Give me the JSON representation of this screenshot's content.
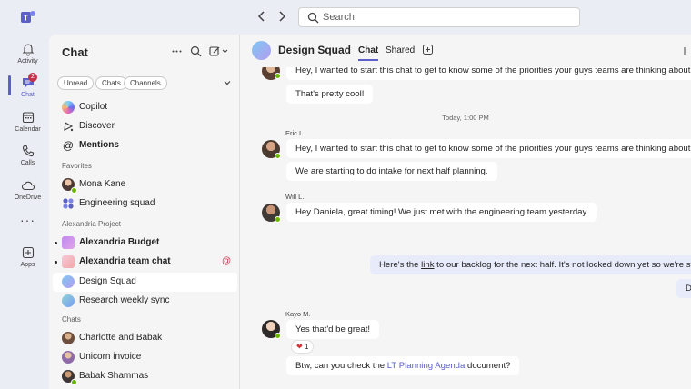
{
  "search": {
    "placeholder": "Search"
  },
  "rail": [
    {
      "label": "Activity",
      "icon": "bell-icon"
    },
    {
      "label": "Chat",
      "icon": "chat-icon",
      "badge": "2",
      "active": true
    },
    {
      "label": "Calendar",
      "icon": "calendar-icon"
    },
    {
      "label": "Calls",
      "icon": "phone-icon"
    },
    {
      "label": "OneDrive",
      "icon": "cloud-icon"
    },
    {
      "label": "Apps",
      "icon": "apps-icon"
    }
  ],
  "panel": {
    "title": "Chat",
    "filters": [
      "Unread",
      "Chats",
      "Channels"
    ],
    "top_items": [
      "Copilot",
      "Discover",
      "Mentions"
    ],
    "favorites_label": "Favorites",
    "favorites": [
      "Mona Kane",
      "Engineering squad"
    ],
    "project_label": "Alexandria Project",
    "project": [
      "Alexandria Budget",
      "Alexandria team chat",
      "Design Squad",
      "Research weekly sync"
    ],
    "mention_badge": "@",
    "chats_label": "Chats",
    "chats": [
      "Charlotte and Babak",
      "Unicorn invoice",
      "Babak Shammas"
    ]
  },
  "header": {
    "title": "Design Squad",
    "tabs": [
      "Chat",
      "Shared"
    ]
  },
  "messages": {
    "m1": "Hey, I wanted to start this chat to get to know some of the priorities your guys teams are thinking about",
    "m2": "That's pretty cool!",
    "time": "Today, 1:00 PM",
    "eric": "Eric I.",
    "m3": "Hey, I wanted to start this chat to get to know some of the priorities your guys teams are thinking about",
    "m4": "We are starting to do intake for next half planning.",
    "will": "Will L.",
    "m5": "Hey Daniela, great timing! We just met with the engineering team yesterday.",
    "m6_pre": "Here's the ",
    "m6_link": "link",
    "m6_post": " to our backlog for the next half. It's not locked down yet so we're still",
    "m7": "D",
    "kayo": "Kayo M.",
    "m8": "Yes that'd be great!",
    "reaction_count": "1",
    "m9_pre": "Btw, can you check the ",
    "m9_link": "LT Planning Agenda",
    "m9_post": " document?"
  }
}
